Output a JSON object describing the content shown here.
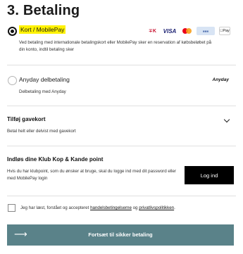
{
  "section_title": "3. Betaling",
  "payment_options": {
    "card": {
      "label": "Kort / MobilePay",
      "description": "Ved betaling med internationale betalingskort eller MobilePay sker en reservation af købsbeløbet på din konto, indtil betaling sker",
      "cards": [
        "Dankort",
        "VISA",
        "Mastercard",
        "MobilePay",
        "Apple Pay"
      ],
      "selected": true
    },
    "anyday": {
      "label": "Anyday delbetaling",
      "description": "Delbetaling med Anyday",
      "logo_text": "Anyday",
      "selected": false
    }
  },
  "giftcard": {
    "title": "Tilføj gavekort",
    "description": "Betal helt eller delvist med gavekort"
  },
  "klub": {
    "title": "Indløs dine Klub Kop & Kande point",
    "description": "Hvis du har klubpoint, som du ønsker at bruge, skal du logge ind med dit password eller med MobilePay login",
    "login_label": "Log ind"
  },
  "terms": {
    "prefix": "Jeg har læst, forstået og accepteret ",
    "link1": "handelsbetingelserne",
    "middle": " og ",
    "link2": "privatlivspolitikken",
    "suffix": "."
  },
  "cta": {
    "label": "Fortsæt til sikker betaling",
    "color": "#5a8289"
  }
}
